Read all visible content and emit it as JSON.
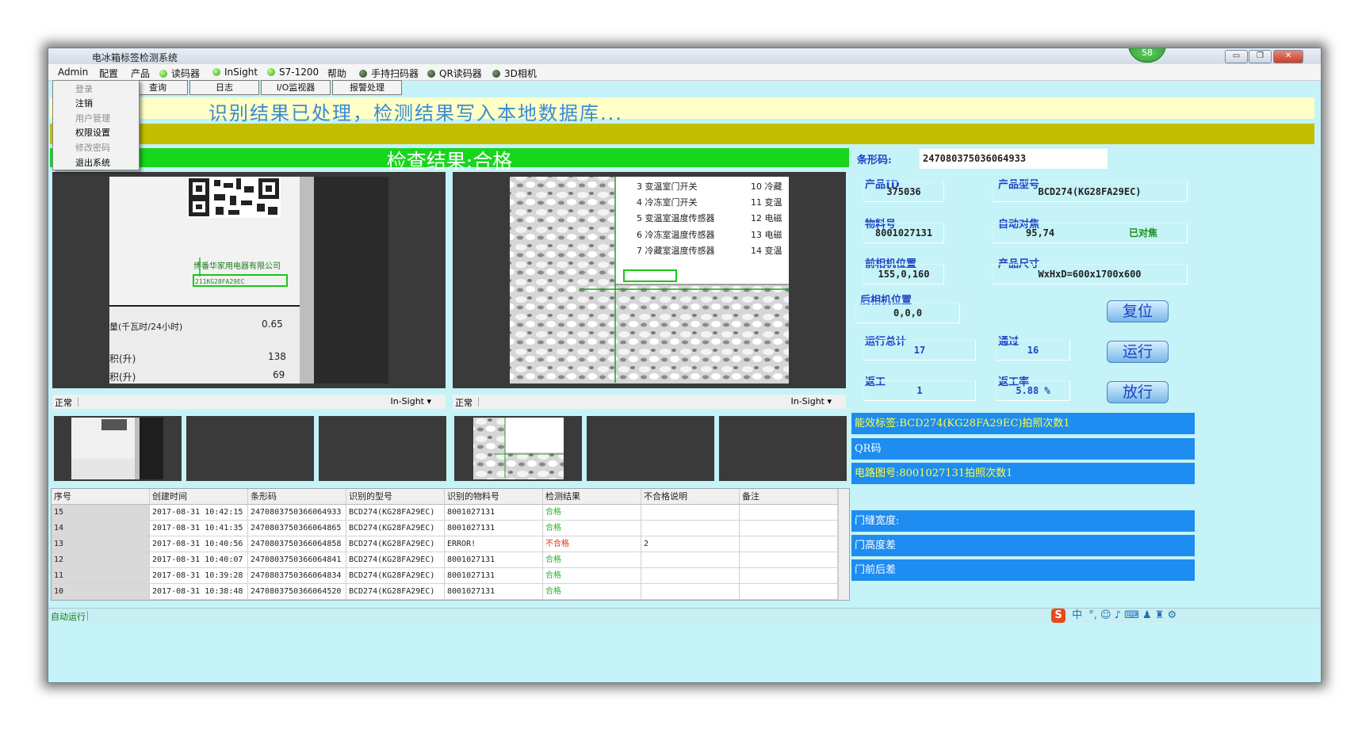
{
  "window": {
    "title": "电冰箱标签检测系统",
    "badge": "58",
    "min": "▭",
    "restore": "❐",
    "close": "✕"
  },
  "menu": {
    "admin": "Admin",
    "config": "配置",
    "product": "产品",
    "devices": [
      {
        "label": "读码器",
        "status": "green"
      },
      {
        "label": "InSight",
        "status": "green"
      },
      {
        "label": "S7-1200",
        "status": "green"
      }
    ],
    "help": "帮助",
    "devices2": [
      {
        "label": "手持扫码器",
        "status": "dark"
      },
      {
        "label": "QR读码器",
        "status": "dark"
      },
      {
        "label": "3D相机",
        "status": "dark"
      }
    ]
  },
  "admin_dropdown": [
    {
      "label": "登录",
      "enabled": false
    },
    {
      "label": "注销",
      "enabled": true
    },
    {
      "label": "用户管理",
      "enabled": false
    },
    {
      "label": "权限设置",
      "enabled": true
    },
    {
      "label": "修改密码",
      "enabled": false
    },
    {
      "label": "退出系统",
      "enabled": true
    }
  ],
  "toolbar": {
    "query": "查询",
    "log": "日志",
    "io_monitor": "I/O监视器",
    "alarm": "报警处理"
  },
  "message": "识别结果已处理，检测结果写入本地数据库...",
  "result_banner": "检查结果:合格",
  "left_view": {
    "company": "博番华家用电器有限公司",
    "code": "211KG28FA29EC",
    "rows": [
      {
        "label": "量(千瓦时/24小时)",
        "value": "0.65"
      },
      {
        "label": "积(升)",
        "value": "138"
      },
      {
        "label": "积(升)",
        "value": "69"
      }
    ],
    "status": "正常",
    "camera": "In-Sight ▾"
  },
  "right_view": {
    "items_left": [
      "3 变温室门开关",
      "4 冷冻室门开关",
      "5 变温室温度传感器",
      "6 冷冻室温度传感器",
      "7 冷藏室温度传感器"
    ],
    "items_right": [
      "10 冷藏",
      "11 变温",
      "12 电磁",
      "13 电磁",
      "14 变温"
    ],
    "status": "正常",
    "camera": "In-Sight ▾"
  },
  "table": {
    "headers": [
      "序号",
      "创建时间",
      "条形码",
      "识别的型号",
      "识别的物料号",
      "检测结果",
      "不合格说明",
      "备注"
    ],
    "rows": [
      [
        "15",
        "2017-08-31 10:42:15",
        "2470803750366064933",
        "BCD274(KG28FA29EC)",
        "8001027131",
        "合格",
        "",
        ""
      ],
      [
        "14",
        "2017-08-31 10:41:35",
        "2470803750366064865",
        "BCD274(KG28FA29EC)",
        "8001027131",
        "合格",
        "",
        ""
      ],
      [
        "13",
        "2017-08-31 10:40:56",
        "2470803750366064858",
        "BCD274(KG28FA29EC)",
        "ERROR!",
        "不合格",
        "2",
        ""
      ],
      [
        "12",
        "2017-08-31 10:40:07",
        "2470803750366064841",
        "BCD274(KG28FA29EC)",
        "8001027131",
        "合格",
        "",
        ""
      ],
      [
        "11",
        "2017-08-31 10:39:28",
        "2470803750366064834",
        "BCD274(KG28FA29EC)",
        "8001027131",
        "合格",
        "",
        ""
      ],
      [
        "10",
        "2017-08-31 10:38:48",
        "2470803750366064520",
        "BCD274(KG28FA29EC)",
        "8001027131",
        "合格",
        "",
        ""
      ]
    ]
  },
  "right_panel": {
    "barcode_label": "条形码:",
    "barcode_value": "247080375036064933",
    "product_id_label": "产品ID",
    "product_id": "375036",
    "product_model_label": "产品型号",
    "product_model": "BCD274(KG28FA29EC)",
    "material_label": "物料号",
    "material": "8001027131",
    "autofocus_label": "自动对焦",
    "autofocus_value": "95,74",
    "autofocus_status": "已对焦",
    "front_cam_label": "前相机位置",
    "front_cam": "155,0,160",
    "size_label": "产品尺寸",
    "size": "WxHxD=600x1700x600",
    "rear_cam_label": "后相机位置",
    "rear_cam": "0,0,0",
    "total_label": "运行总计",
    "total": "17",
    "pass_label": "通过",
    "pass": "16",
    "rework_label": "返工",
    "rework": "1",
    "rework_rate_label": "返工率",
    "rework_rate": "5.88 %",
    "reset_btn": "复位",
    "run_btn": "运行",
    "release_btn": "放行"
  },
  "info_bars": {
    "energy_label": "能效标签:BCD274(KG28FA29EC)拍照次数1",
    "qr": "QR码",
    "circuit": "电路图号:8001027131拍照次数1",
    "gap_width": "门缝宽度:",
    "height_diff": "门高度差",
    "front_back": "门前后差"
  },
  "statusbar": {
    "text": "自动运行",
    "ime_logo": "S",
    "ime_lang": "中",
    "ime_symbols": "°, ☺ ♪ ⌨ ♟ ♜ ⚙"
  }
}
